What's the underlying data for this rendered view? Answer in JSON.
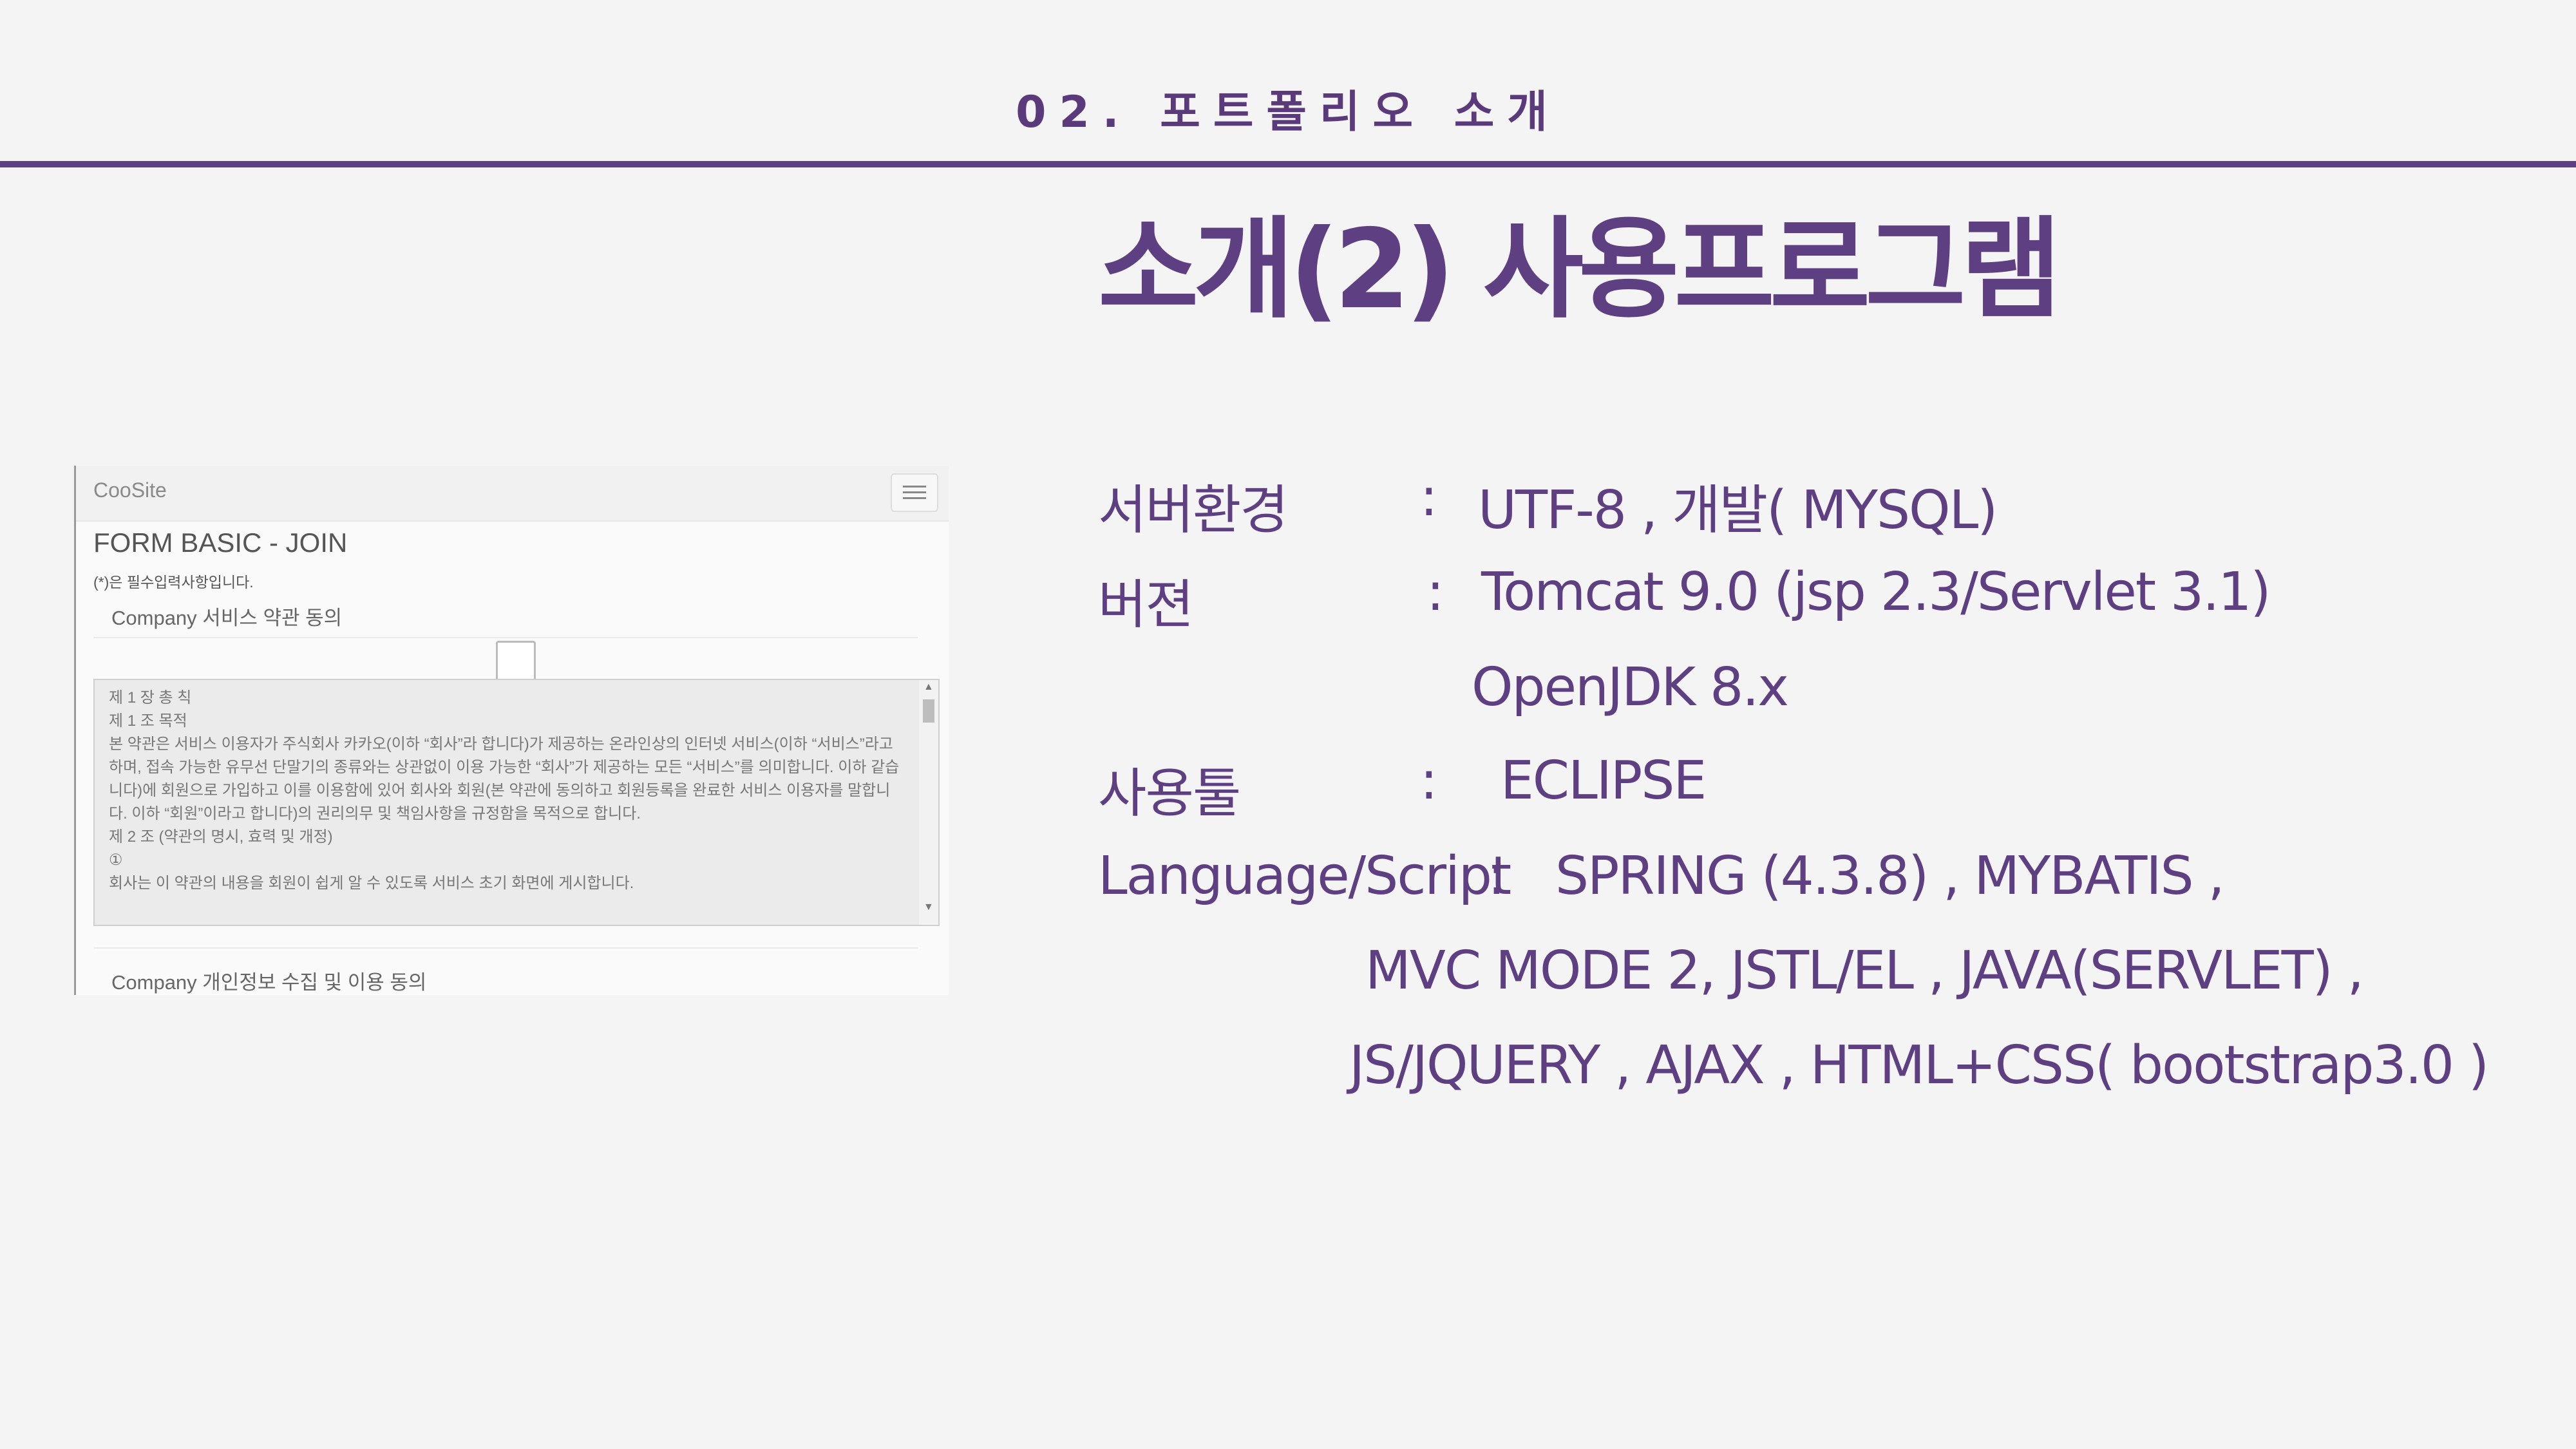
{
  "header": {
    "section_label": "02. 포트폴리오 소개",
    "title": "소개(2) 사용프로그램"
  },
  "screenshot": {
    "brand": "CooSite",
    "menu_icon": "hamburger-icon",
    "heading": "FORM BASIC - JOIN",
    "required_note": "(*)은 필수입력사항입니다.",
    "terms_agree_label": "Company 서비스 약관 동의",
    "terms_lines": [
      "제 1 장 총 칙",
      "제 1 조 목적",
      "본 약관은 서비스 이용자가 주식회사 카카오(이하 “회사”라 합니다)가 제공하는 온라인상의 인터넷 서비스(이하 “서비스”라고 하며, 접속 가능한 유무선 단말기의 종류와는 상관없이 이용 가능한 “회사”가 제공하는 모든 “서비스”를 의미합니다. 이하 같습니다)에 회원으로 가입하고 이를 이용함에 있어 회사와 회원(본 약관에 동의하고 회원등록을 완료한 서비스 이용자를 말합니다. 이하 “회원”이라고 합니다)의 권리의무 및 책임사항을 규정함을 목적으로 합니다.",
      "",
      "제 2 조 (약관의 명시, 효력 및 개정)",
      "①",
      "회사는 이 약관의 내용을 회원이 쉽게 알 수 있도록 서비스 초기 화면에 게시합니다."
    ],
    "privacy_agree_label": "Company 개인정보 수집 및 이용 동의"
  },
  "info": {
    "server_label": "서버환경",
    "server_colon": ":",
    "server_value": "UTF-8 ,   개발( MYSQL)",
    "version_label": "버젼",
    "version_colon": ":",
    "version_value": "Tomcat 9.0 (jsp 2.3/Servlet 3.1)",
    "version_value2": "OpenJDK 8.x",
    "tool_label": "사용툴",
    "tool_colon": ":",
    "tool_value": "ECLIPSE",
    "lang_label": "Language/Script",
    "lang_colon": ":",
    "lang_line1": "SPRING (4.3.8)    ,    MYBATIS ,",
    "lang_line2": "MVC MODE 2,   JSTL/EL ,  JAVA(SERVLET) ,",
    "lang_line3": "JS/JQUERY   , AJAX , HTML+CSS(  bootstrap3.0  )"
  }
}
